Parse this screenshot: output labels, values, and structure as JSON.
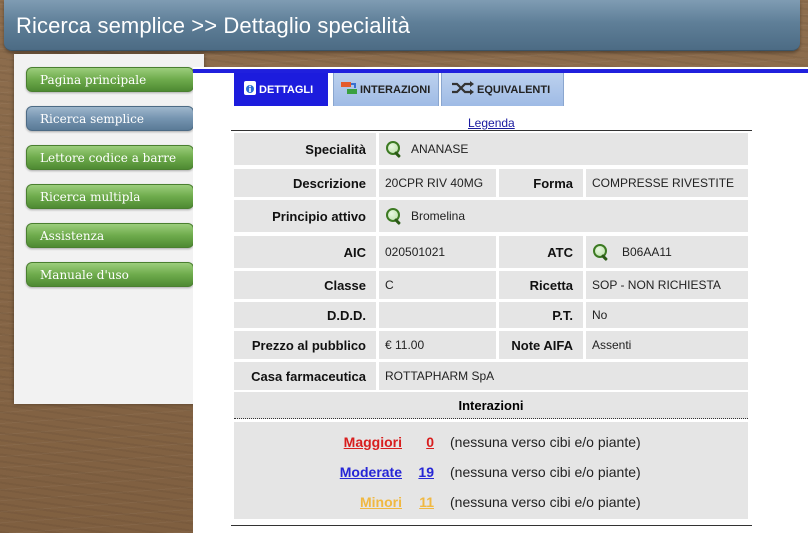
{
  "header": {
    "title": "Ricerca semplice >> Dettaglio specialità"
  },
  "sidebar": {
    "items": [
      {
        "label": "Pagina principale",
        "active": false
      },
      {
        "label": "Ricerca semplice",
        "active": true
      },
      {
        "label": "Lettore codice a barre",
        "active": false
      },
      {
        "label": "Ricerca multipla",
        "active": false
      },
      {
        "label": "Assistenza",
        "active": false
      },
      {
        "label": "Manuale d'uso",
        "active": false
      }
    ]
  },
  "tabs": [
    {
      "label": "DETTAGLI",
      "icon": "info-icon",
      "active": true
    },
    {
      "label": "INTERAZIONI",
      "icon": "interactions-icon",
      "active": false
    },
    {
      "label": "EQUIVALENTI",
      "icon": "shuffle-icon",
      "active": false
    }
  ],
  "legenda": "Legenda",
  "details": {
    "specialita_label": "Specialità",
    "specialita": "ANANASE",
    "descrizione_label": "Descrizione",
    "descrizione": "20CPR RIV 40MG",
    "forma_label": "Forma",
    "forma": "COMPRESSE RIVESTITE",
    "principio_label": "Principio attivo",
    "principio": "Bromelina",
    "aic_label": "AIC",
    "aic": "020501021",
    "atc_label": "ATC",
    "atc": "B06AA11",
    "classe_label": "Classe",
    "classe": "C",
    "ricetta_label": "Ricetta",
    "ricetta": "SOP - NON RICHIESTA",
    "ddd_label": "D.D.D.",
    "ddd": "",
    "pt_label": "P.T.",
    "pt": "No",
    "prezzo_label": "Prezzo al pubblico",
    "prezzo": "€ 11.00",
    "note_label": "Note AIFA",
    "note": "Assenti",
    "casa_label": "Casa farmaceutica",
    "casa": "ROTTAPHARM SpA"
  },
  "interazioni": {
    "title": "Interazioni",
    "rows": [
      {
        "label": "Maggiori",
        "count": "0",
        "note": "(nessuna verso cibi e/o piante)",
        "color": "#d81e1e"
      },
      {
        "label": "Moderate",
        "count": "19",
        "note": "(nessuna verso cibi e/o piante)",
        "color": "#2626d6"
      },
      {
        "label": "Minori",
        "count": "11",
        "note": "(nessuna verso cibi e/o piante)",
        "color": "#f0b840"
      }
    ]
  }
}
